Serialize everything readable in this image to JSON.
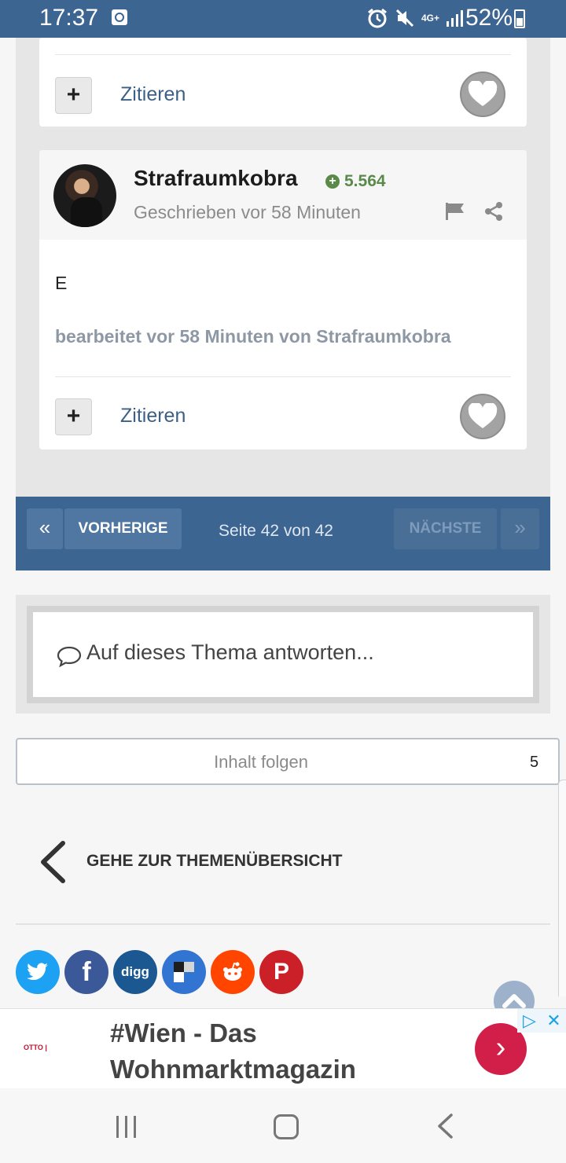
{
  "status_bar": {
    "time": "17:37",
    "network": "4G+",
    "battery_percent": "52%",
    "icons": [
      "clock-widget-icon",
      "alarm-icon",
      "mute-icon",
      "signal-icon",
      "battery-icon"
    ]
  },
  "post_prev": {
    "quote_label": "Zitieren"
  },
  "post": {
    "author": "Strafraumkobra",
    "reputation": "5.564",
    "posted": "Geschrieben vor 58 Minuten",
    "body": "E",
    "edited": "bearbeitet vor 58 Minuten von Strafraumkobra",
    "quote_label": "Zitieren"
  },
  "pagination": {
    "first": "«",
    "prev": "VORHERIGE",
    "info": "Seite 42 von 42",
    "next": "NÄCHSTE",
    "last": "»"
  },
  "reply": {
    "placeholder": "Auf dieses Thema antworten..."
  },
  "follow": {
    "label": "Inhalt folgen",
    "count": "5"
  },
  "back": {
    "label": "GEHE ZUR THEMENÜBERSICHT"
  },
  "share": [
    {
      "name": "twitter",
      "glyph": "",
      "color": "#1da1f2"
    },
    {
      "name": "facebook",
      "glyph": "f",
      "color": "#3b5998"
    },
    {
      "name": "digg",
      "glyph": "digg",
      "color": "#1b5891"
    },
    {
      "name": "delicious",
      "glyph": "",
      "color": "#3274d1"
    },
    {
      "name": "reddit",
      "glyph": "",
      "color": "#ff4500"
    },
    {
      "name": "pinterest",
      "glyph": "P",
      "color": "#cb2027"
    }
  ],
  "ad": {
    "title_line1": "#Wien - Das",
    "title_line2": "Wohnmarktmagazin",
    "logo_text": "OTTO | ",
    "cta": "›",
    "choices_close": "✕"
  },
  "colors": {
    "brand_blue": "#3d6592",
    "link_blue": "#3c5f86",
    "reputation_green": "#5a8a4a",
    "ad_cta_red": "#d21f4a"
  }
}
